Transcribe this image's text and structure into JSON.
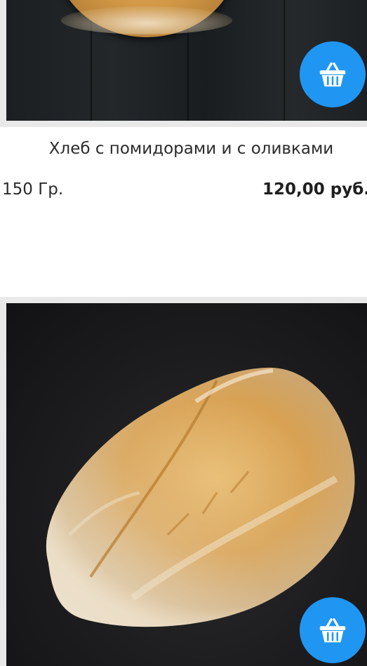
{
  "products": [
    {
      "name": "Хлеб с помидорами и с оливками",
      "weight": "150 Гр.",
      "price": "120,00 руб.",
      "cart_icon": "basket-icon"
    },
    {
      "cart_icon": "basket-icon"
    }
  ],
  "colors": {
    "accent": "#2096f3",
    "frame": "#e9e9e9",
    "text": "#2b2b2b"
  }
}
